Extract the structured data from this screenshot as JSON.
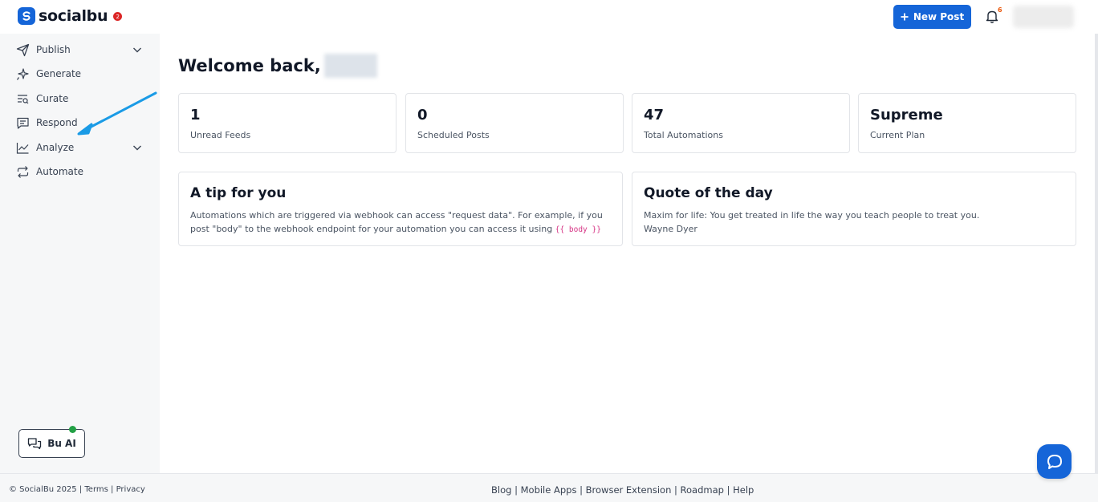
{
  "brand": {
    "name": "socialbu",
    "badge": "2"
  },
  "header": {
    "new_post_label": "New Post",
    "notification_count": "6"
  },
  "sidebar": {
    "items": [
      {
        "label": "Publish",
        "icon": "send-icon",
        "has_chevron": true
      },
      {
        "label": "Generate",
        "icon": "sparkle-icon",
        "has_chevron": false
      },
      {
        "label": "Curate",
        "icon": "curate-icon",
        "has_chevron": false
      },
      {
        "label": "Respond",
        "icon": "message-icon",
        "has_chevron": false
      },
      {
        "label": "Analyze",
        "icon": "chart-line-icon",
        "has_chevron": true
      },
      {
        "label": "Automate",
        "icon": "repeat-icon",
        "has_chevron": false
      }
    ],
    "bu_ai_label": "Bu AI"
  },
  "main": {
    "welcome": "Welcome back,",
    "stats": [
      {
        "value": "1",
        "label": "Unread Feeds"
      },
      {
        "value": "0",
        "label": "Scheduled Posts"
      },
      {
        "value": "47",
        "label": "Total Automations"
      },
      {
        "value": "Supreme",
        "label": "Current Plan"
      }
    ],
    "tip": {
      "title": "A tip for you",
      "body": "Automations which are triggered via webhook can access \"request data\". For example, if you post \"body\" to the webhook endpoint for your automation you can access it using ",
      "code": "{{ body }}"
    },
    "quote": {
      "title": "Quote of the day",
      "text": "Maxim for life: You get treated in life the way you teach people to treat you.",
      "author": "Wayne Dyer"
    }
  },
  "footer": {
    "copyright": "© SocialBu 2025",
    "left_links": [
      "Terms",
      "Privacy"
    ],
    "right_links": [
      "Blog",
      "Mobile Apps",
      "Browser Extension",
      "Roadmap",
      "Help"
    ]
  },
  "colors": {
    "primary": "#1565d8",
    "arrow": "#1a9be6",
    "online": "#22a045"
  }
}
